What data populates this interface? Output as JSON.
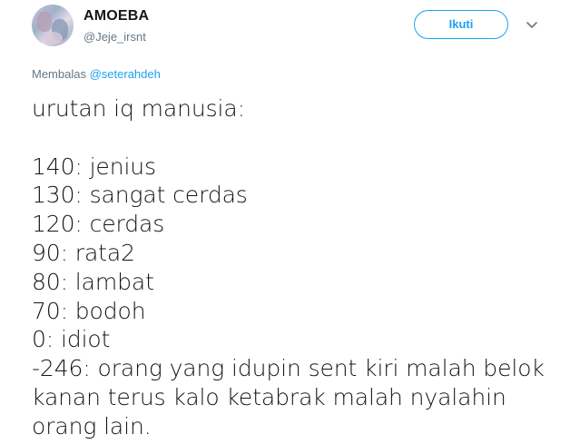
{
  "author": {
    "display_name": "AMOEBA",
    "handle": "@Jeje_irsnt",
    "avatar_icon": "profile-photo"
  },
  "actions": {
    "follow_label": "Ikuti",
    "caret_icon": "chevron-down-icon"
  },
  "reply": {
    "prefix": "Membalas",
    "mention": "@seterahdeh"
  },
  "tweet": {
    "lines": [
      "urutan iq manusia:",
      "",
      "140: jenius",
      "130: sangat cerdas",
      "120: cerdas",
      "90: rata2",
      "80: lambat",
      "70: bodoh",
      "0: idiot",
      "-246: orang yang idupin sent kiri malah belok",
      "kanan terus kalo ketabrak malah nyalahin",
      "orang lain."
    ]
  },
  "colors": {
    "accent": "#1da1f2",
    "text": "#14171a",
    "secondary": "#657786"
  }
}
